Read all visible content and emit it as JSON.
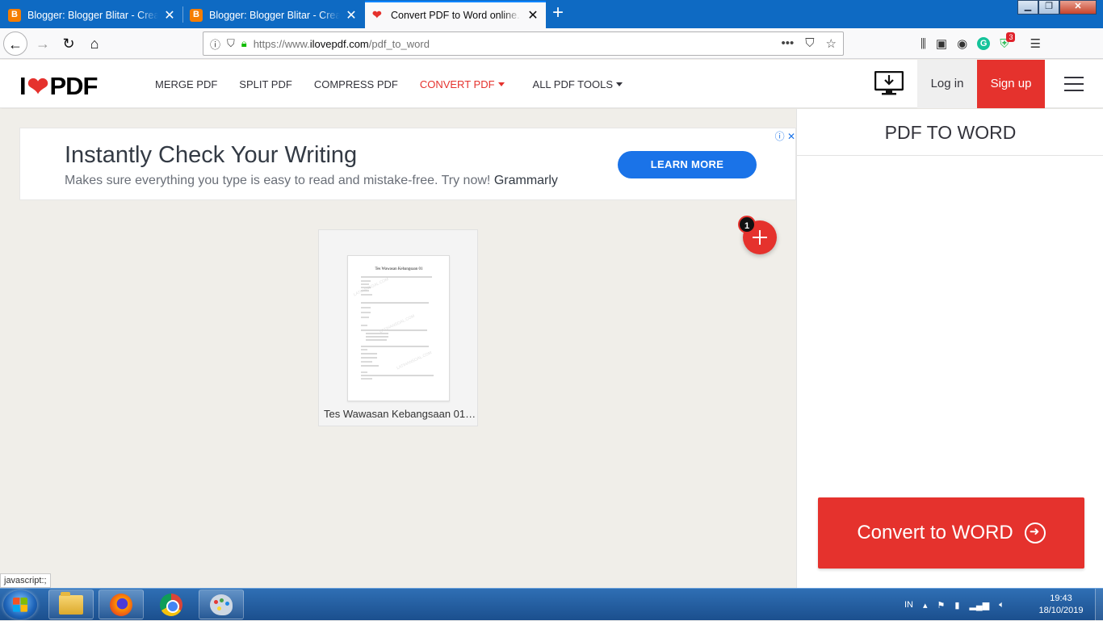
{
  "browser": {
    "tabs": [
      {
        "title": "Blogger: Blogger Blitar - Create",
        "favicon": "blogger-icon",
        "active": false
      },
      {
        "title": "Blogger: Blogger Blitar - Create",
        "favicon": "blogger-icon",
        "active": false
      },
      {
        "title": "Convert PDF to Word online. Fr",
        "favicon": "ilovepdf-heart-icon",
        "active": true
      }
    ],
    "url": {
      "scheme": "https://www.",
      "host": "ilovepdf.com",
      "path": "/pdf_to_word"
    },
    "extension_badge": "3",
    "status_text": "javascript:;"
  },
  "site": {
    "logo": {
      "left": "I",
      "right": "PDF"
    },
    "menu": [
      {
        "label": "MERGE PDF",
        "active": false,
        "dropdown": false
      },
      {
        "label": "SPLIT PDF",
        "active": false,
        "dropdown": false
      },
      {
        "label": "COMPRESS PDF",
        "active": false,
        "dropdown": false
      },
      {
        "label": "CONVERT PDF",
        "active": true,
        "dropdown": true
      },
      {
        "label": "ALL PDF TOOLS",
        "active": false,
        "dropdown": true
      }
    ],
    "login_label": "Log in",
    "signup_label": "Sign up",
    "accent_color": "#e5322d"
  },
  "ad": {
    "title": "Instantly Check Your Writing",
    "description": "Makes sure everything you type is easy to read and mistake-free. Try now!",
    "brand": "Grammarly",
    "button_label": "LEARN MORE"
  },
  "workspace": {
    "file_count_badge": "1",
    "files": [
      {
        "name": "Tes Wawasan Kebangsaan 01…",
        "thumbnail_heading": "Tes Wawasan Kebangsaan 01"
      }
    ]
  },
  "sidebar": {
    "title": "PDF TO WORD",
    "convert_label": "Convert to WORD"
  },
  "taskbar": {
    "language": "IN",
    "time": "19:43",
    "date": "18/10/2019"
  }
}
